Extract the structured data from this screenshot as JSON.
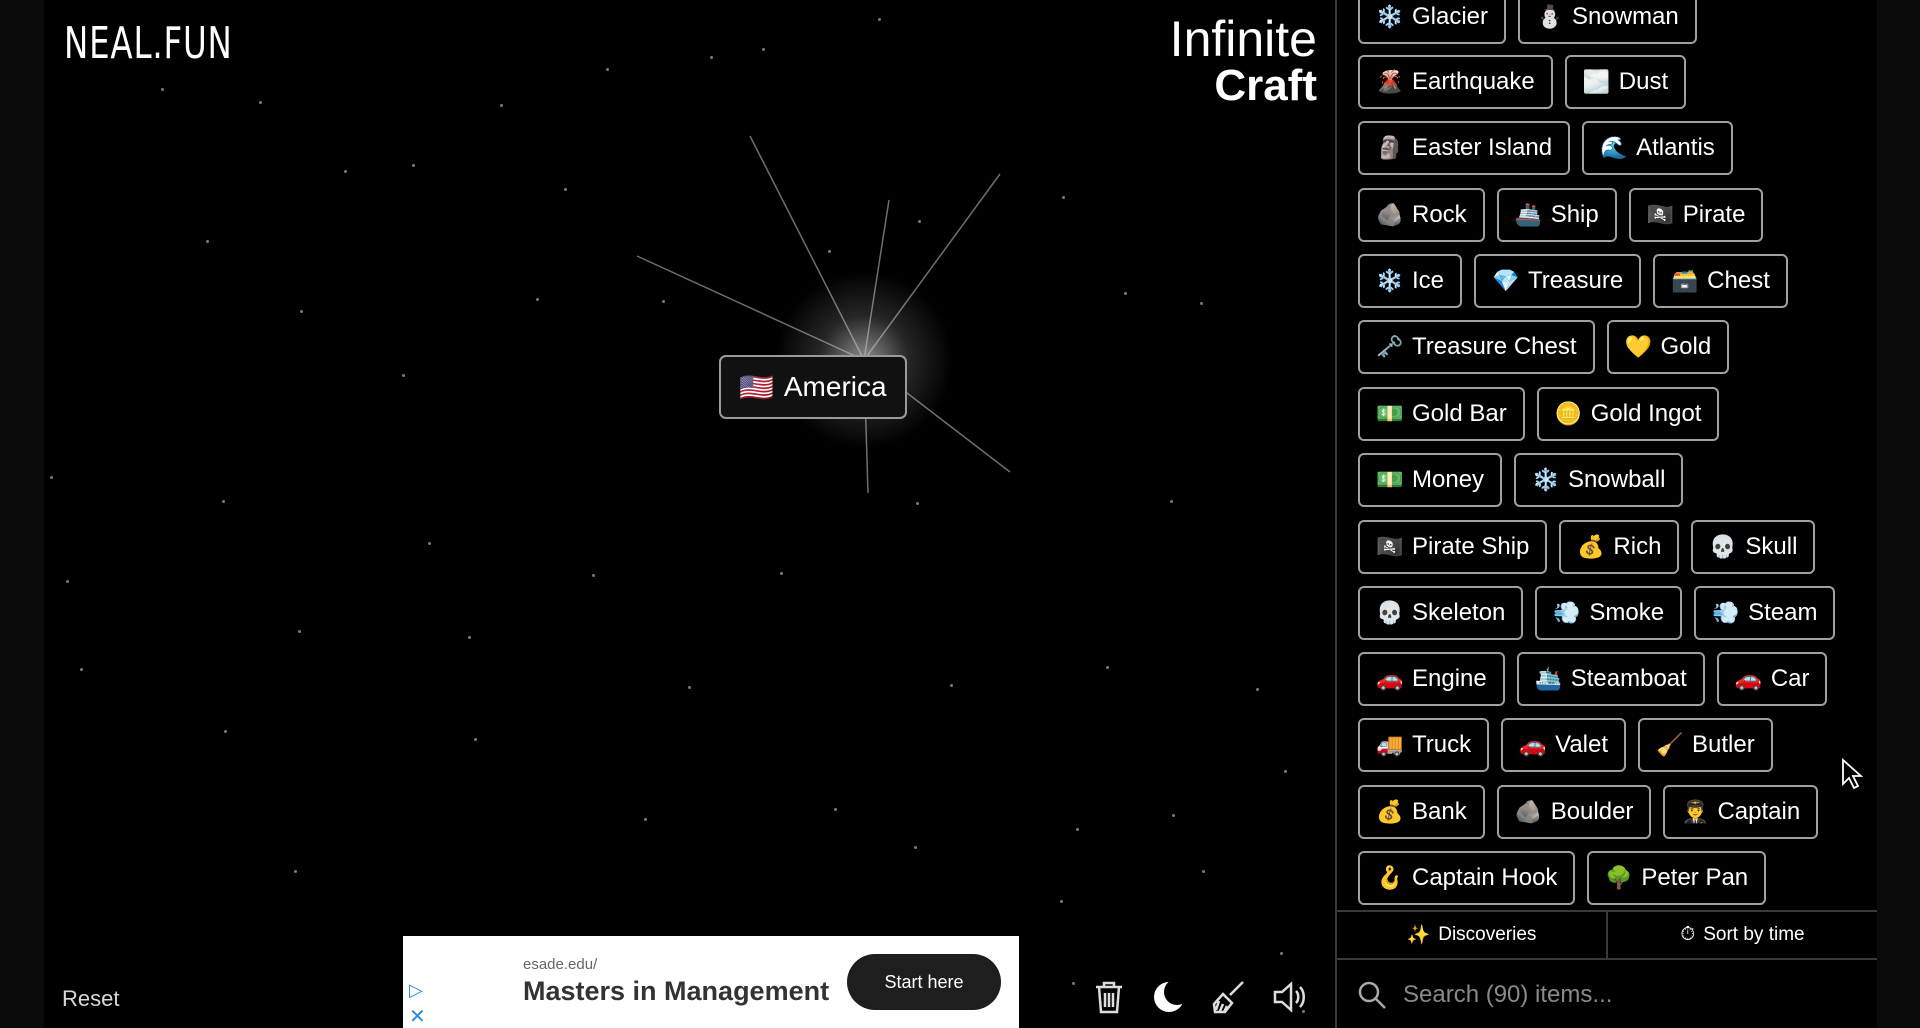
{
  "logo": "NEAL.FUN",
  "brand": {
    "line1": "Infinite",
    "line2": "Craft"
  },
  "canvas_item": {
    "emoji": "🇺🇸",
    "label": "America"
  },
  "reset_label": "Reset",
  "ad": {
    "url": "esade.edu/",
    "headline": "Masters in Management",
    "cta": "Start here",
    "choice_icon": "▷",
    "close_icon": "✕"
  },
  "tabs": {
    "discoveries": "Discoveries",
    "sort": "Sort by time"
  },
  "search": {
    "placeholder": "Search (90) items..."
  },
  "items": [
    [
      {
        "emoji": "❄️",
        "label": "Glacier"
      },
      {
        "emoji": "⛄",
        "label": "Snowman"
      }
    ],
    [
      {
        "emoji": "🌋",
        "label": "Earthquake"
      },
      {
        "emoji": "🌫️",
        "label": "Dust"
      }
    ],
    [
      {
        "emoji": "🗿",
        "label": "Easter Island"
      },
      {
        "emoji": "🌊",
        "label": "Atlantis"
      }
    ],
    [
      {
        "emoji": "🪨",
        "label": "Rock"
      },
      {
        "emoji": "🚢",
        "label": "Ship"
      },
      {
        "emoji": "🏴‍☠️",
        "label": "Pirate"
      }
    ],
    [
      {
        "emoji": "❄️",
        "label": "Ice"
      },
      {
        "emoji": "💎",
        "label": "Treasure"
      },
      {
        "emoji": "🗃️",
        "label": "Chest"
      }
    ],
    [
      {
        "emoji": "🗝️",
        "label": "Treasure Chest"
      },
      {
        "emoji": "💛",
        "label": "Gold"
      }
    ],
    [
      {
        "emoji": "💵",
        "label": "Gold Bar"
      },
      {
        "emoji": "🪙",
        "label": "Gold Ingot"
      }
    ],
    [
      {
        "emoji": "💵",
        "label": "Money"
      },
      {
        "emoji": "❄️",
        "label": "Snowball"
      }
    ],
    [
      {
        "emoji": "🏴‍☠️",
        "label": "Pirate Ship"
      },
      {
        "emoji": "💰",
        "label": "Rich"
      },
      {
        "emoji": "💀",
        "label": "Skull"
      }
    ],
    [
      {
        "emoji": "💀",
        "label": "Skeleton"
      },
      {
        "emoji": "💨",
        "label": "Smoke"
      },
      {
        "emoji": "💨",
        "label": "Steam"
      }
    ],
    [
      {
        "emoji": "🚗",
        "label": "Engine"
      },
      {
        "emoji": "🛳️",
        "label": "Steamboat"
      },
      {
        "emoji": "🚗",
        "label": "Car"
      }
    ],
    [
      {
        "emoji": "🚚",
        "label": "Truck"
      },
      {
        "emoji": "🚗",
        "label": "Valet"
      },
      {
        "emoji": "🧹",
        "label": "Butler"
      }
    ],
    [
      {
        "emoji": "💰",
        "label": "Bank"
      },
      {
        "emoji": "🪨",
        "label": "Boulder"
      },
      {
        "emoji": "👨‍✈️",
        "label": "Captain"
      }
    ],
    [
      {
        "emoji": "🪝",
        "label": "Captain Hook"
      },
      {
        "emoji": "🌳",
        "label": "Peter Pan"
      }
    ]
  ]
}
